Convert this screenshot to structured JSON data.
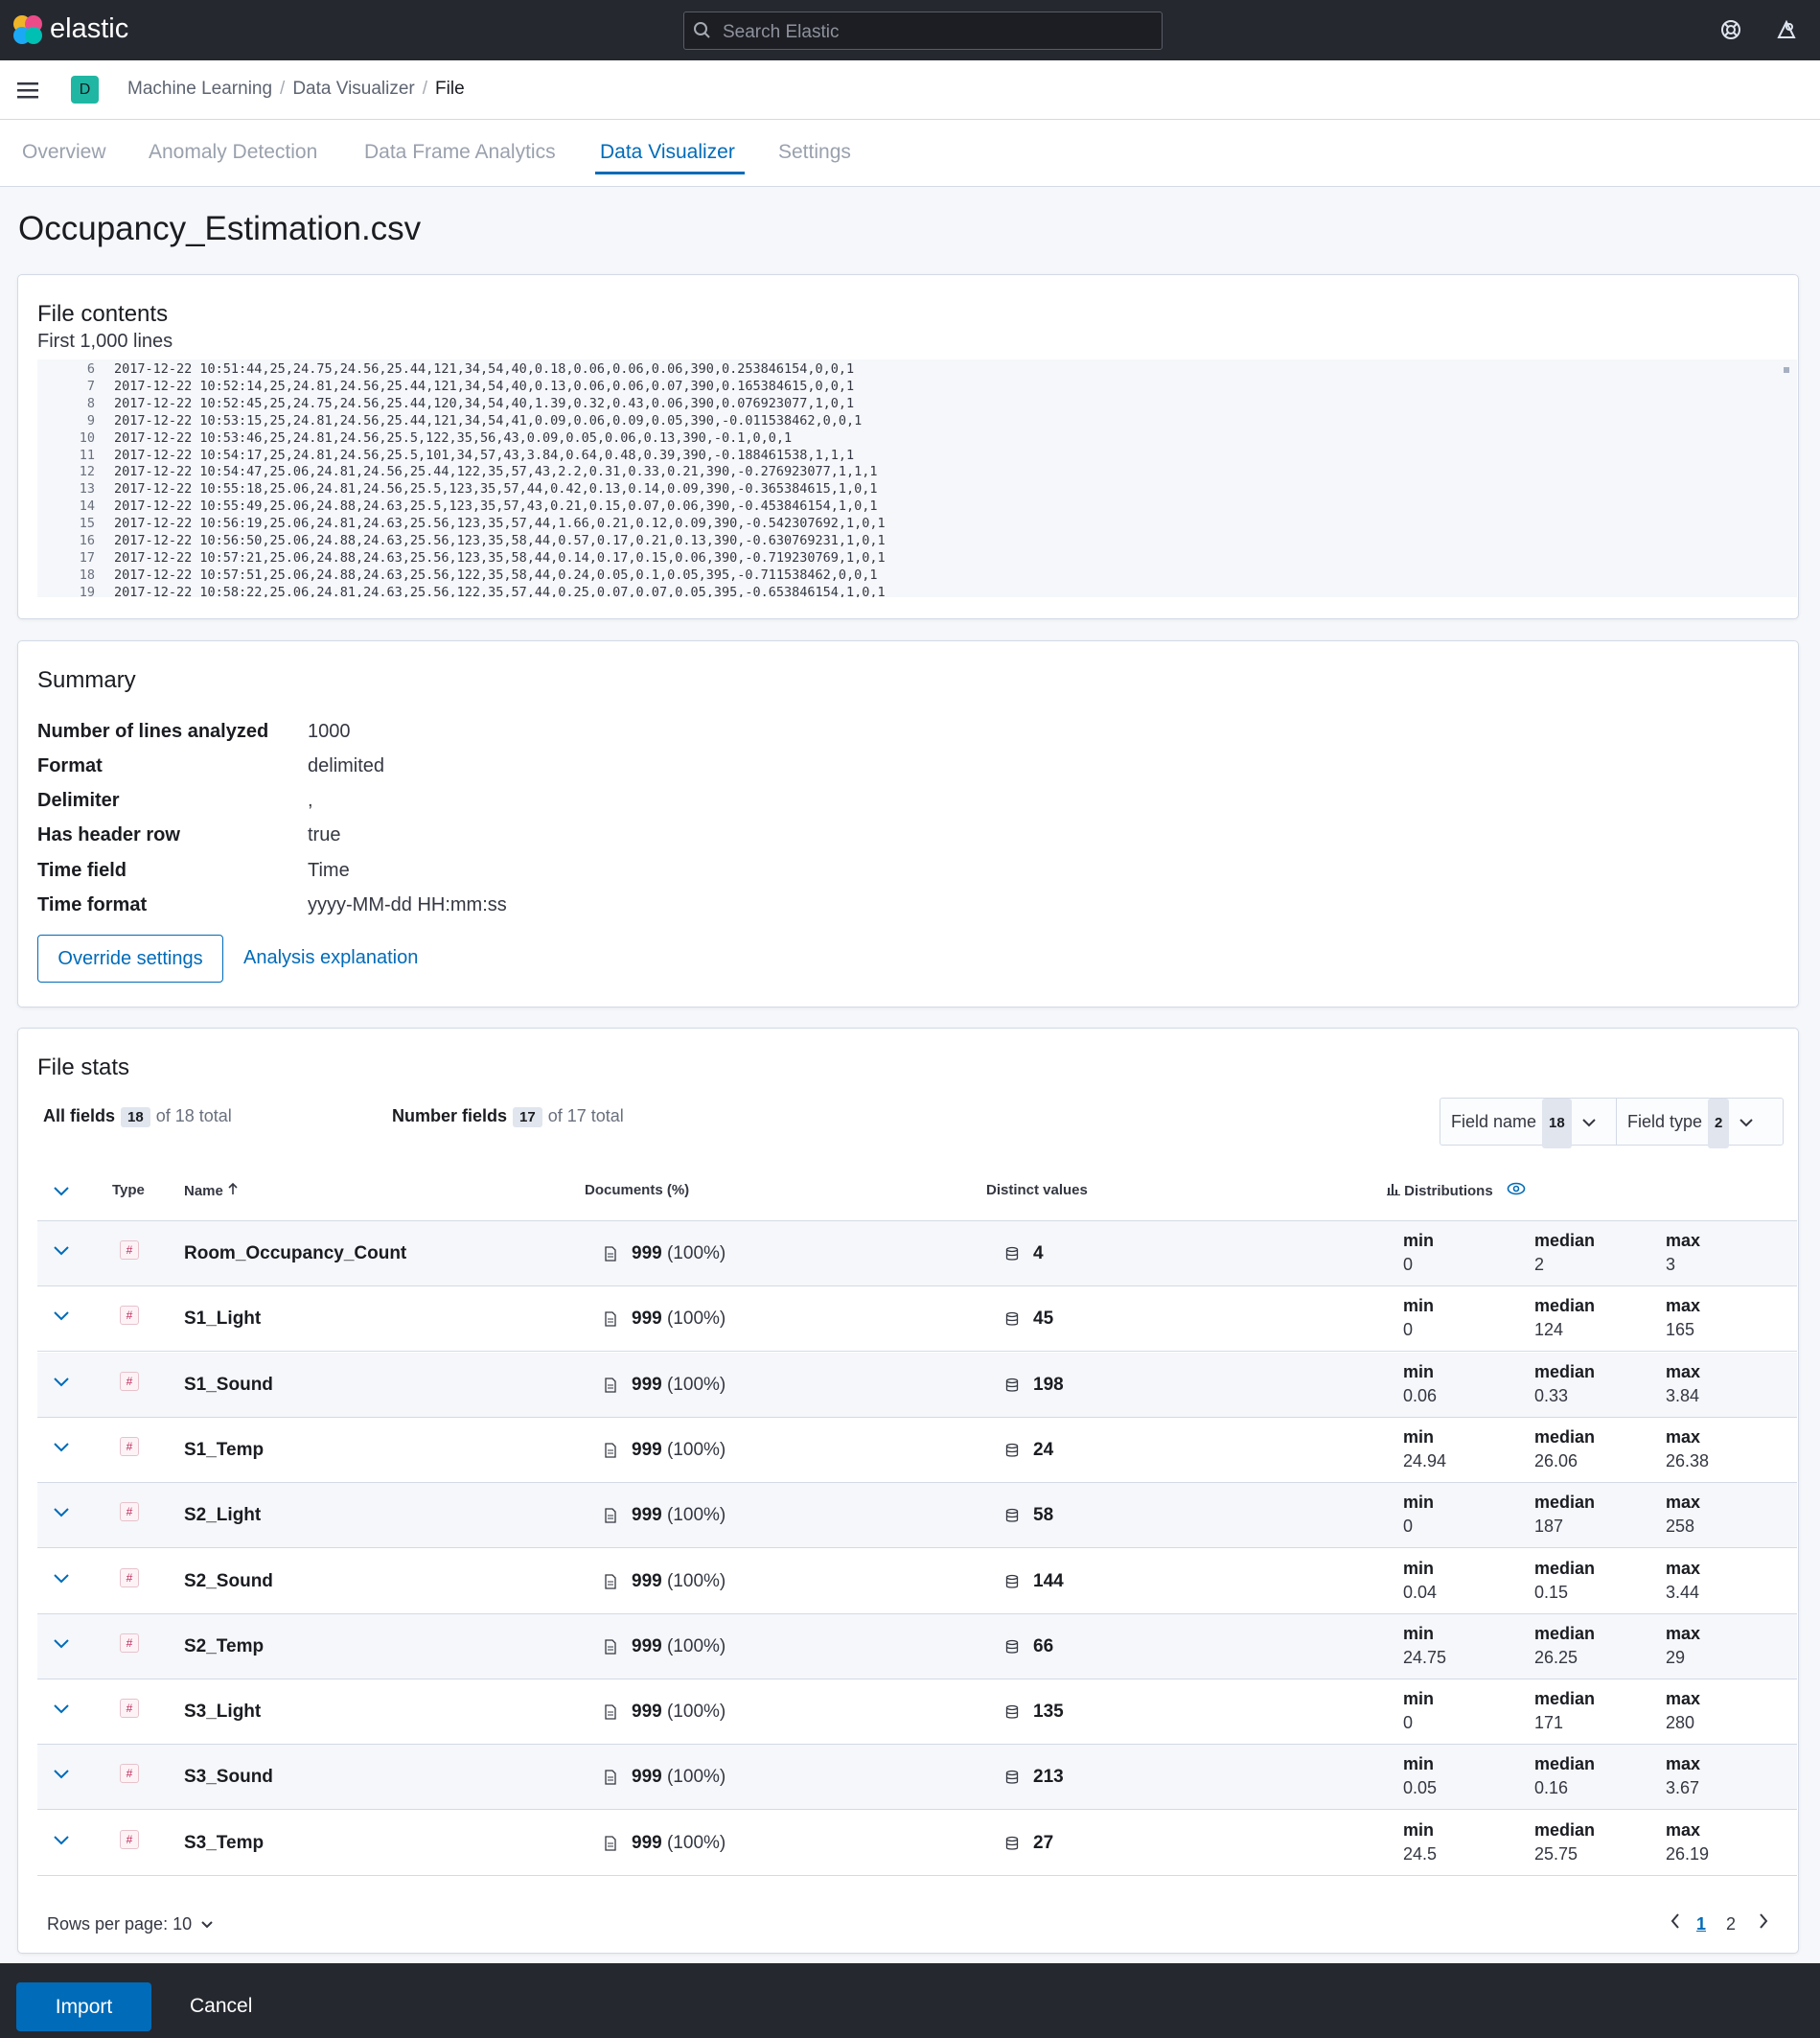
{
  "header": {
    "brand": "elastic",
    "search_placeholder": "Search Elastic",
    "space_initial": "D",
    "breadcrumbs": [
      "Machine Learning",
      "Data Visualizer",
      "File"
    ]
  },
  "tabs": [
    "Overview",
    "Anomaly Detection",
    "Data Frame Analytics",
    "Data Visualizer",
    "Settings"
  ],
  "active_tab": "Data Visualizer",
  "page_title": "Occupancy_Estimation.csv",
  "file_contents": {
    "title": "File contents",
    "subtitle": "First 1,000 lines",
    "lines": [
      {
        "n": "6",
        "text": "2017-12-22 10:51:44,25,24.75,24.56,25.44,121,34,54,40,0.18,0.06,0.06,0.06,390,0.253846154,0,0,1"
      },
      {
        "n": "7",
        "text": "2017-12-22 10:52:14,25,24.81,24.56,25.44,121,34,54,40,0.13,0.06,0.06,0.07,390,0.165384615,0,0,1"
      },
      {
        "n": "8",
        "text": "2017-12-22 10:52:45,25,24.75,24.56,25.44,120,34,54,40,1.39,0.32,0.43,0.06,390,0.076923077,1,0,1"
      },
      {
        "n": "9",
        "text": "2017-12-22 10:53:15,25,24.81,24.56,25.44,121,34,54,41,0.09,0.06,0.09,0.05,390,-0.011538462,0,0,1"
      },
      {
        "n": "10",
        "text": "2017-12-22 10:53:46,25,24.81,24.56,25.5,122,35,56,43,0.09,0.05,0.06,0.13,390,-0.1,0,0,1"
      },
      {
        "n": "11",
        "text": "2017-12-22 10:54:17,25,24.81,24.56,25.5,101,34,57,43,3.84,0.64,0.48,0.39,390,-0.188461538,1,1,1"
      },
      {
        "n": "12",
        "text": "2017-12-22 10:54:47,25.06,24.81,24.56,25.44,122,35,57,43,2.2,0.31,0.33,0.21,390,-0.276923077,1,1,1"
      },
      {
        "n": "13",
        "text": "2017-12-22 10:55:18,25.06,24.81,24.56,25.5,123,35,57,44,0.42,0.13,0.14,0.09,390,-0.365384615,1,0,1"
      },
      {
        "n": "14",
        "text": "2017-12-22 10:55:49,25.06,24.88,24.63,25.5,123,35,57,43,0.21,0.15,0.07,0.06,390,-0.453846154,1,0,1"
      },
      {
        "n": "15",
        "text": "2017-12-22 10:56:19,25.06,24.81,24.63,25.56,123,35,57,44,1.66,0.21,0.12,0.09,390,-0.542307692,1,0,1"
      },
      {
        "n": "16",
        "text": "2017-12-22 10:56:50,25.06,24.88,24.63,25.56,123,35,58,44,0.57,0.17,0.21,0.13,390,-0.630769231,1,0,1"
      },
      {
        "n": "17",
        "text": "2017-12-22 10:57:21,25.06,24.88,24.63,25.56,123,35,58,44,0.14,0.17,0.15,0.06,390,-0.719230769,1,0,1"
      },
      {
        "n": "18",
        "text": "2017-12-22 10:57:51,25.06,24.88,24.63,25.56,122,35,58,44,0.24,0.05,0.1,0.05,395,-0.711538462,0,0,1"
      },
      {
        "n": "19",
        "text": "2017-12-22 10:58:22,25.06,24.81,24.63,25.56,122,35,57,44,0.25,0.07,0.07,0.05,395,-0.653846154,1,0,1"
      }
    ]
  },
  "summary": {
    "title": "Summary",
    "rows": [
      {
        "key": "Number of lines analyzed",
        "value": "1000"
      },
      {
        "key": "Format",
        "value": "delimited"
      },
      {
        "key": "Delimiter",
        "value": ","
      },
      {
        "key": "Has header row",
        "value": "true"
      },
      {
        "key": "Time field",
        "value": "Time"
      },
      {
        "key": "Time format",
        "value": "yyyy-MM-dd HH:mm:ss"
      }
    ],
    "override_label": "Override settings",
    "explanation_label": "Analysis explanation"
  },
  "file_stats": {
    "title": "File stats",
    "all_fields_label": "All fields",
    "all_fields_count": "18",
    "all_fields_total": "of 18 total",
    "number_fields_label": "Number fields",
    "number_fields_count": "17",
    "number_fields_total": "of 17 total",
    "field_name_filter": "Field name",
    "field_name_count": "18",
    "field_type_filter": "Field type",
    "field_type_count": "2",
    "columns": {
      "type": "Type",
      "name": "Name",
      "documents": "Documents (%)",
      "distinct": "Distinct values",
      "distributions": "Distributions"
    },
    "stat_labels": {
      "min": "min",
      "median": "median",
      "max": "max"
    },
    "rows": [
      {
        "name": "Room_Occupancy_Count",
        "docs": "999",
        "pct": "(100%)",
        "distinct": "4",
        "min": "0",
        "median": "2",
        "max": "3"
      },
      {
        "name": "S1_Light",
        "docs": "999",
        "pct": "(100%)",
        "distinct": "45",
        "min": "0",
        "median": "124",
        "max": "165"
      },
      {
        "name": "S1_Sound",
        "docs": "999",
        "pct": "(100%)",
        "distinct": "198",
        "min": "0.06",
        "median": "0.33",
        "max": "3.84"
      },
      {
        "name": "S1_Temp",
        "docs": "999",
        "pct": "(100%)",
        "distinct": "24",
        "min": "24.94",
        "median": "26.06",
        "max": "26.38"
      },
      {
        "name": "S2_Light",
        "docs": "999",
        "pct": "(100%)",
        "distinct": "58",
        "min": "0",
        "median": "187",
        "max": "258"
      },
      {
        "name": "S2_Sound",
        "docs": "999",
        "pct": "(100%)",
        "distinct": "144",
        "min": "0.04",
        "median": "0.15",
        "max": "3.44"
      },
      {
        "name": "S2_Temp",
        "docs": "999",
        "pct": "(100%)",
        "distinct": "66",
        "min": "24.75",
        "median": "26.25",
        "max": "29"
      },
      {
        "name": "S3_Light",
        "docs": "999",
        "pct": "(100%)",
        "distinct": "135",
        "min": "0",
        "median": "171",
        "max": "280"
      },
      {
        "name": "S3_Sound",
        "docs": "999",
        "pct": "(100%)",
        "distinct": "213",
        "min": "0.05",
        "median": "0.16",
        "max": "3.67"
      },
      {
        "name": "S3_Temp",
        "docs": "999",
        "pct": "(100%)",
        "distinct": "27",
        "min": "24.5",
        "median": "25.75",
        "max": "26.19"
      }
    ],
    "rows_per_page": "Rows per page: 10",
    "pages": [
      "1",
      "2"
    ]
  },
  "footer": {
    "import_label": "Import",
    "cancel_label": "Cancel"
  },
  "colors": {
    "accent": "#006bb8",
    "header_bg": "#25282f",
    "space_badge": "#1fb7a4",
    "number_type": "#bd2a5b"
  }
}
